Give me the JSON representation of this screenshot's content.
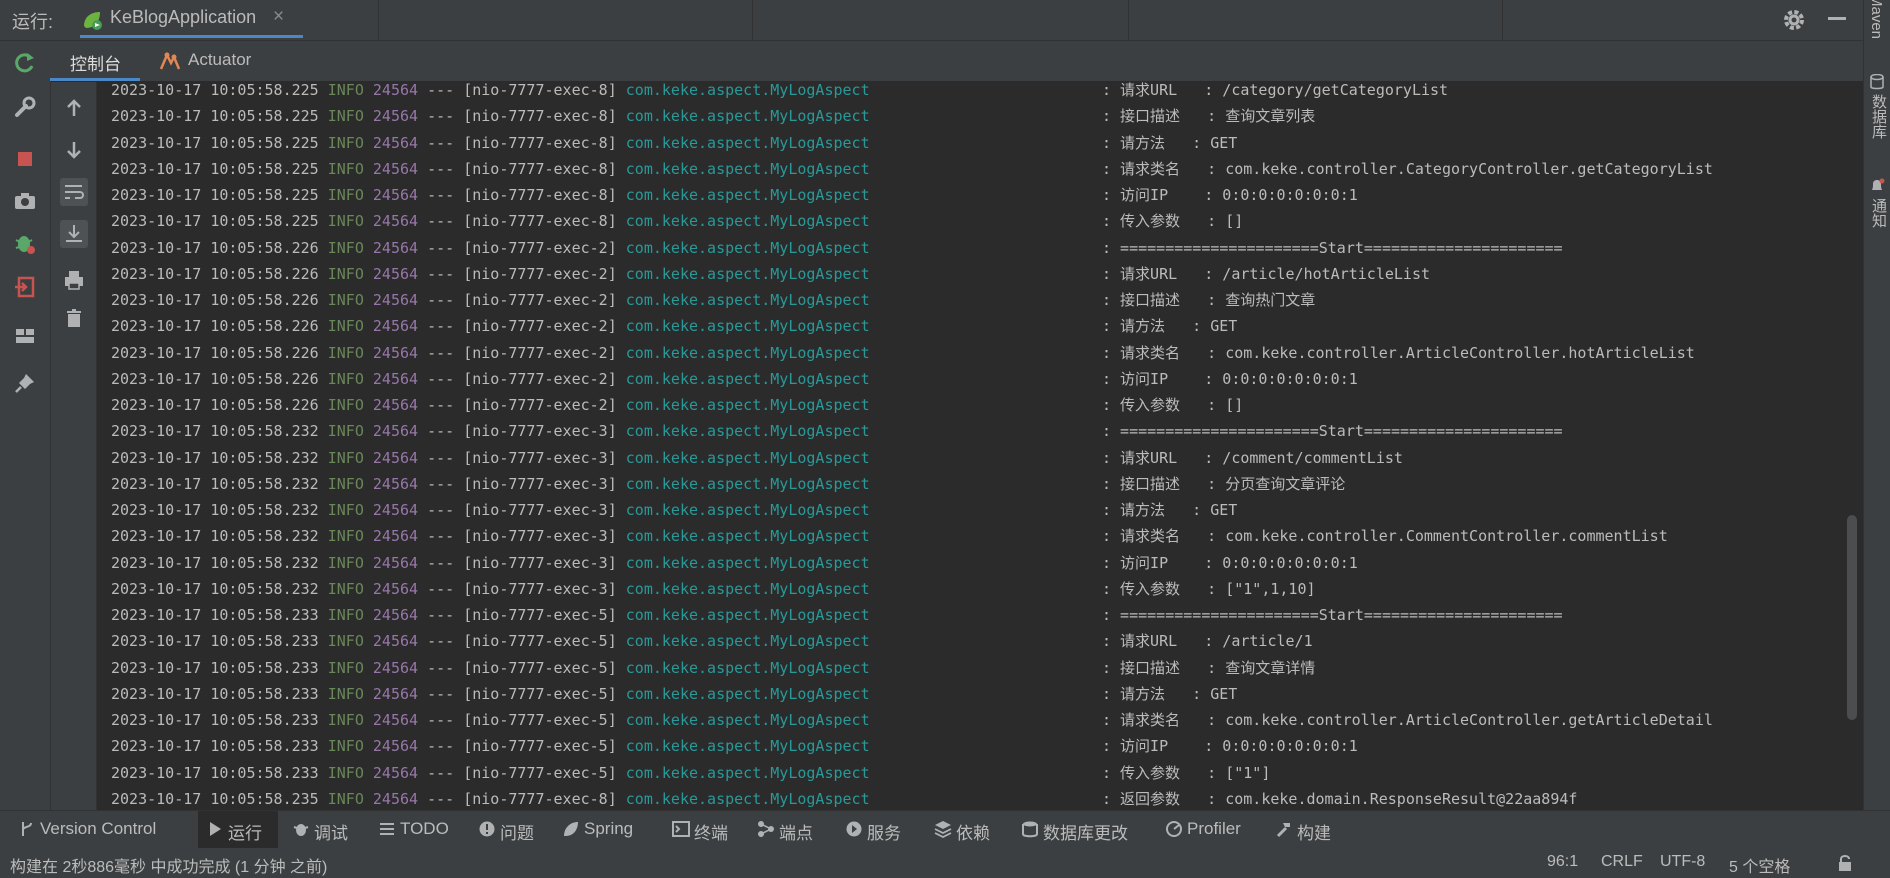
{
  "topbar": {
    "run_label": "运行:",
    "tab_title": "KeBlogApplication",
    "close_glyph": "×"
  },
  "right_strip": {
    "maven": "Maven",
    "database": "数据库",
    "notifications": "通知"
  },
  "subtabs": {
    "console": "控制台",
    "actuator": "Actuator"
  },
  "console": {
    "colors": {
      "info": "#6a8759",
      "pid": "#9876aa",
      "logger": "#299999",
      "text": "#bbbbbb"
    },
    "lines": [
      {
        "ts": "2023-10-17 10:05:58.225",
        "level": "INFO",
        "pid": "24564",
        "sep": "---",
        "thread": "[nio-7777-exec-8]",
        "logger": "com.keke.aspect.MyLogAspect",
        "message": ": 请求URL   : /category/getCategoryList"
      },
      {
        "ts": "2023-10-17 10:05:58.225",
        "level": "INFO",
        "pid": "24564",
        "sep": "---",
        "thread": "[nio-7777-exec-8]",
        "logger": "com.keke.aspect.MyLogAspect",
        "message": ": 接口描述   : 查询文章列表"
      },
      {
        "ts": "2023-10-17 10:05:58.225",
        "level": "INFO",
        "pid": "24564",
        "sep": "---",
        "thread": "[nio-7777-exec-8]",
        "logger": "com.keke.aspect.MyLogAspect",
        "message": ": 请方法   : GET"
      },
      {
        "ts": "2023-10-17 10:05:58.225",
        "level": "INFO",
        "pid": "24564",
        "sep": "---",
        "thread": "[nio-7777-exec-8]",
        "logger": "com.keke.aspect.MyLogAspect",
        "message": ": 请求类名   : com.keke.controller.CategoryController.getCategoryList"
      },
      {
        "ts": "2023-10-17 10:05:58.225",
        "level": "INFO",
        "pid": "24564",
        "sep": "---",
        "thread": "[nio-7777-exec-8]",
        "logger": "com.keke.aspect.MyLogAspect",
        "message": ": 访问IP    : 0:0:0:0:0:0:0:1"
      },
      {
        "ts": "2023-10-17 10:05:58.225",
        "level": "INFO",
        "pid": "24564",
        "sep": "---",
        "thread": "[nio-7777-exec-8]",
        "logger": "com.keke.aspect.MyLogAspect",
        "message": ": 传入参数   : []"
      },
      {
        "ts": "2023-10-17 10:05:58.226",
        "level": "INFO",
        "pid": "24564",
        "sep": "---",
        "thread": "[nio-7777-exec-2]",
        "logger": "com.keke.aspect.MyLogAspect",
        "message": ": ======================Start======================"
      },
      {
        "ts": "2023-10-17 10:05:58.226",
        "level": "INFO",
        "pid": "24564",
        "sep": "---",
        "thread": "[nio-7777-exec-2]",
        "logger": "com.keke.aspect.MyLogAspect",
        "message": ": 请求URL   : /article/hotArticleList"
      },
      {
        "ts": "2023-10-17 10:05:58.226",
        "level": "INFO",
        "pid": "24564",
        "sep": "---",
        "thread": "[nio-7777-exec-2]",
        "logger": "com.keke.aspect.MyLogAspect",
        "message": ": 接口描述   : 查询热门文章"
      },
      {
        "ts": "2023-10-17 10:05:58.226",
        "level": "INFO",
        "pid": "24564",
        "sep": "---",
        "thread": "[nio-7777-exec-2]",
        "logger": "com.keke.aspect.MyLogAspect",
        "message": ": 请方法   : GET"
      },
      {
        "ts": "2023-10-17 10:05:58.226",
        "level": "INFO",
        "pid": "24564",
        "sep": "---",
        "thread": "[nio-7777-exec-2]",
        "logger": "com.keke.aspect.MyLogAspect",
        "message": ": 请求类名   : com.keke.controller.ArticleController.hotArticleList"
      },
      {
        "ts": "2023-10-17 10:05:58.226",
        "level": "INFO",
        "pid": "24564",
        "sep": "---",
        "thread": "[nio-7777-exec-2]",
        "logger": "com.keke.aspect.MyLogAspect",
        "message": ": 访问IP    : 0:0:0:0:0:0:0:1"
      },
      {
        "ts": "2023-10-17 10:05:58.226",
        "level": "INFO",
        "pid": "24564",
        "sep": "---",
        "thread": "[nio-7777-exec-2]",
        "logger": "com.keke.aspect.MyLogAspect",
        "message": ": 传入参数   : []"
      },
      {
        "ts": "2023-10-17 10:05:58.232",
        "level": "INFO",
        "pid": "24564",
        "sep": "---",
        "thread": "[nio-7777-exec-3]",
        "logger": "com.keke.aspect.MyLogAspect",
        "message": ": ======================Start======================"
      },
      {
        "ts": "2023-10-17 10:05:58.232",
        "level": "INFO",
        "pid": "24564",
        "sep": "---",
        "thread": "[nio-7777-exec-3]",
        "logger": "com.keke.aspect.MyLogAspect",
        "message": ": 请求URL   : /comment/commentList"
      },
      {
        "ts": "2023-10-17 10:05:58.232",
        "level": "INFO",
        "pid": "24564",
        "sep": "---",
        "thread": "[nio-7777-exec-3]",
        "logger": "com.keke.aspect.MyLogAspect",
        "message": ": 接口描述   : 分页查询文章评论"
      },
      {
        "ts": "2023-10-17 10:05:58.232",
        "level": "INFO",
        "pid": "24564",
        "sep": "---",
        "thread": "[nio-7777-exec-3]",
        "logger": "com.keke.aspect.MyLogAspect",
        "message": ": 请方法   : GET"
      },
      {
        "ts": "2023-10-17 10:05:58.232",
        "level": "INFO",
        "pid": "24564",
        "sep": "---",
        "thread": "[nio-7777-exec-3]",
        "logger": "com.keke.aspect.MyLogAspect",
        "message": ": 请求类名   : com.keke.controller.CommentController.commentList"
      },
      {
        "ts": "2023-10-17 10:05:58.232",
        "level": "INFO",
        "pid": "24564",
        "sep": "---",
        "thread": "[nio-7777-exec-3]",
        "logger": "com.keke.aspect.MyLogAspect",
        "message": ": 访问IP    : 0:0:0:0:0:0:0:1"
      },
      {
        "ts": "2023-10-17 10:05:58.232",
        "level": "INFO",
        "pid": "24564",
        "sep": "---",
        "thread": "[nio-7777-exec-3]",
        "logger": "com.keke.aspect.MyLogAspect",
        "message": ": 传入参数   : [\"1\",1,10]"
      },
      {
        "ts": "2023-10-17 10:05:58.233",
        "level": "INFO",
        "pid": "24564",
        "sep": "---",
        "thread": "[nio-7777-exec-5]",
        "logger": "com.keke.aspect.MyLogAspect",
        "message": ": ======================Start======================"
      },
      {
        "ts": "2023-10-17 10:05:58.233",
        "level": "INFO",
        "pid": "24564",
        "sep": "---",
        "thread": "[nio-7777-exec-5]",
        "logger": "com.keke.aspect.MyLogAspect",
        "message": ": 请求URL   : /article/1"
      },
      {
        "ts": "2023-10-17 10:05:58.233",
        "level": "INFO",
        "pid": "24564",
        "sep": "---",
        "thread": "[nio-7777-exec-5]",
        "logger": "com.keke.aspect.MyLogAspect",
        "message": ": 接口描述   : 查询文章详情"
      },
      {
        "ts": "2023-10-17 10:05:58.233",
        "level": "INFO",
        "pid": "24564",
        "sep": "---",
        "thread": "[nio-7777-exec-5]",
        "logger": "com.keke.aspect.MyLogAspect",
        "message": ": 请方法   : GET"
      },
      {
        "ts": "2023-10-17 10:05:58.233",
        "level": "INFO",
        "pid": "24564",
        "sep": "---",
        "thread": "[nio-7777-exec-5]",
        "logger": "com.keke.aspect.MyLogAspect",
        "message": ": 请求类名   : com.keke.controller.ArticleController.getArticleDetail"
      },
      {
        "ts": "2023-10-17 10:05:58.233",
        "level": "INFO",
        "pid": "24564",
        "sep": "---",
        "thread": "[nio-7777-exec-5]",
        "logger": "com.keke.aspect.MyLogAspect",
        "message": ": 访问IP    : 0:0:0:0:0:0:0:1"
      },
      {
        "ts": "2023-10-17 10:05:58.233",
        "level": "INFO",
        "pid": "24564",
        "sep": "---",
        "thread": "[nio-7777-exec-5]",
        "logger": "com.keke.aspect.MyLogAspect",
        "message": ": 传入参数   : [\"1\"]"
      },
      {
        "ts": "2023-10-17 10:05:58.235",
        "level": "INFO",
        "pid": "24564",
        "sep": "---",
        "thread": "[nio-7777-exec-8]",
        "logger": "com.keke.aspect.MyLogAspect",
        "message": ": 返回参数   : com.keke.domain.ResponseResult@22aa894f"
      }
    ]
  },
  "toolwindows": [
    {
      "label": "Version Control",
      "icon": "branch-icon",
      "active": false
    },
    {
      "label": "运行",
      "icon": "run-icon",
      "active": true
    },
    {
      "label": "调试",
      "icon": "debug-icon",
      "active": false
    },
    {
      "label": "TODO",
      "icon": "list-icon",
      "active": false
    },
    {
      "label": "问题",
      "icon": "info-icon",
      "active": false
    },
    {
      "label": "Spring",
      "icon": "spring-icon",
      "active": false
    },
    {
      "label": "终端",
      "icon": "terminal-icon",
      "active": false
    },
    {
      "label": "端点",
      "icon": "endpoints-icon",
      "active": false
    },
    {
      "label": "服务",
      "icon": "services-icon",
      "active": false
    },
    {
      "label": "依赖",
      "icon": "dependencies-icon",
      "active": false
    },
    {
      "label": "数据库更改",
      "icon": "database-changes-icon",
      "active": false
    },
    {
      "label": "Profiler",
      "icon": "profiler-icon",
      "active": false
    },
    {
      "label": "构建",
      "icon": "build-icon",
      "active": false
    }
  ],
  "statusbar": {
    "message": "构建在 2秒886毫秒 中成功完成 (1 分钟 之前)",
    "position": "96:1",
    "line_separator": "CRLF",
    "encoding": "UTF-8",
    "indent": "5 个空格"
  }
}
